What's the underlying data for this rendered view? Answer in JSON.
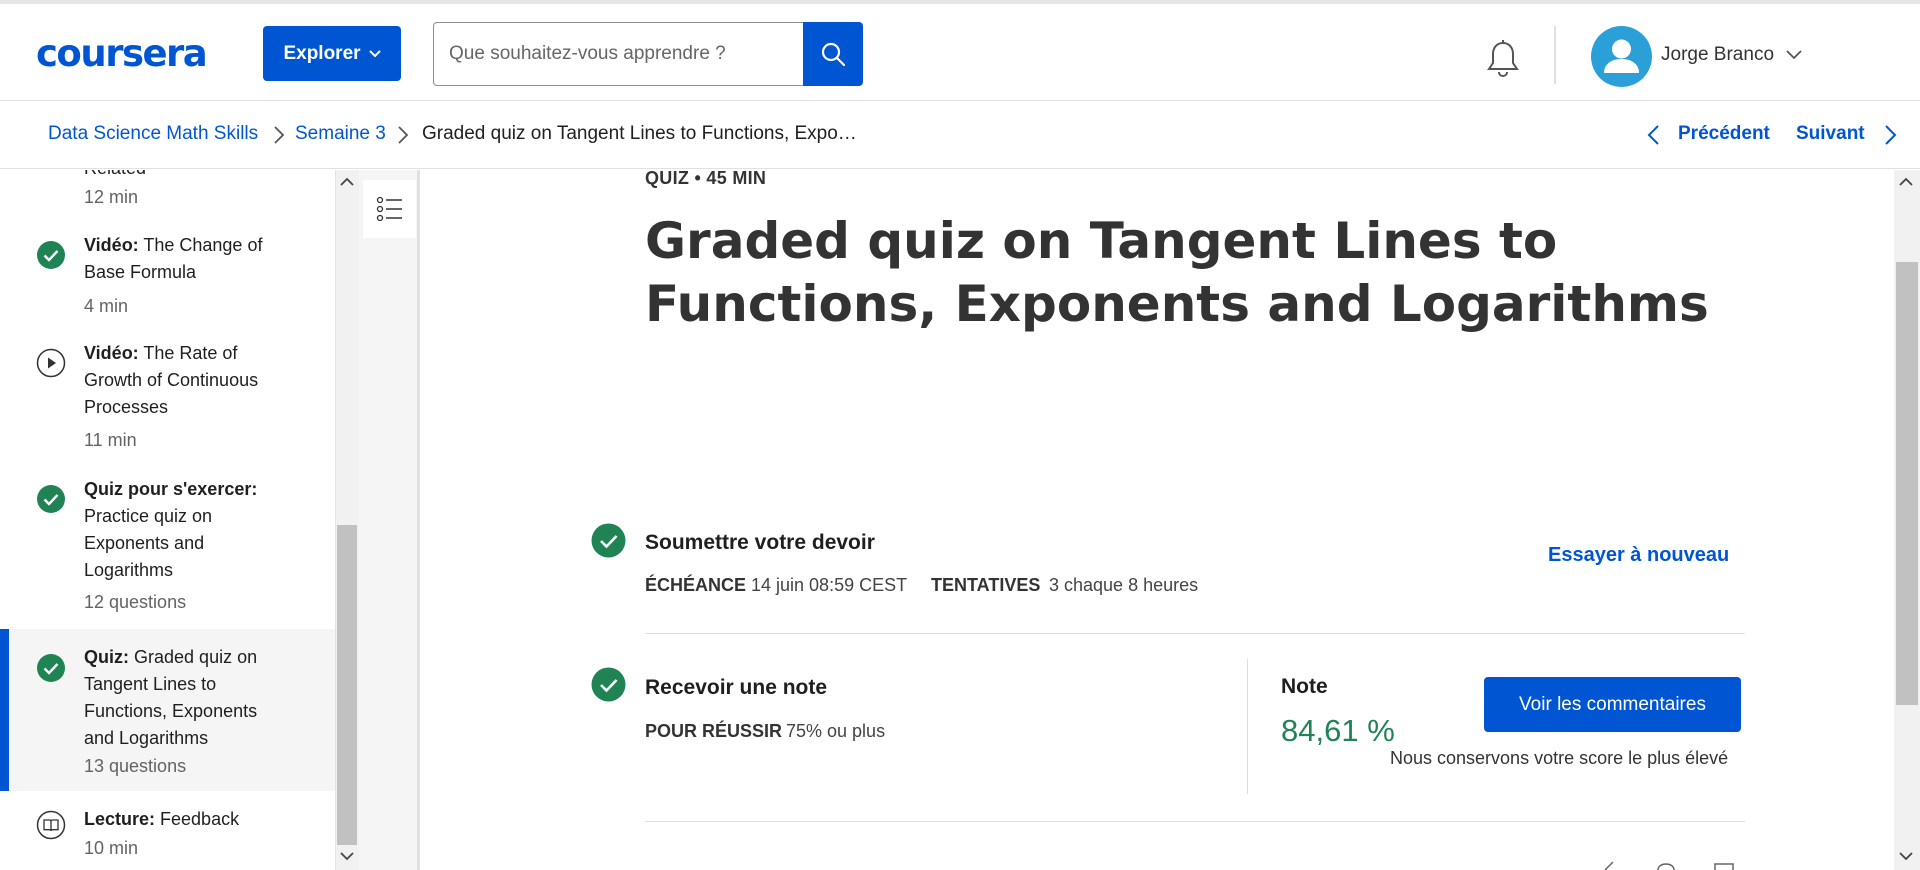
{
  "header": {
    "logo_text": "coursera",
    "explore_label": "Explorer",
    "search_placeholder": "Que souhaitez-vous apprendre ?",
    "user_name": "Jorge Branco",
    "brand_color": "#0056d2"
  },
  "breadcrumb": {
    "items": [
      "Data Science Math Skills",
      "Semaine 3",
      "Graded quiz on Tangent Lines to Functions, Expo…"
    ],
    "prev_label": "Précédent",
    "next_label": "Suivant"
  },
  "sidebar": {
    "items": [
      {
        "type_label": "",
        "title": "Related",
        "meta": "12 min",
        "icon": "check-circle-icon",
        "status": "completed"
      },
      {
        "type_label": "Vidéo:",
        "title": "The Change of Base Formula",
        "meta": "4 min",
        "icon": "check-circle-icon",
        "status": "completed"
      },
      {
        "type_label": "Vidéo:",
        "title": "The Rate of Growth of Continuous Processes",
        "meta": "11 min",
        "icon": "play-circle-icon",
        "status": "not-started"
      },
      {
        "type_label": "Quiz pour s'exercer:",
        "title": "Practice quiz on Exponents and Logarithms",
        "meta": "12 questions",
        "icon": "check-circle-icon",
        "status": "completed"
      },
      {
        "type_label": "Quiz:",
        "title": "Graded quiz on Tangent Lines to Functions, Exponents and Logarithms",
        "meta": "13 questions",
        "icon": "check-circle-icon",
        "status": "completed-active"
      },
      {
        "type_label": "Lecture:",
        "title": "Feedback",
        "meta": "10 min",
        "icon": "book-circle-icon",
        "status": "not-started"
      }
    ]
  },
  "quiz": {
    "meta": "QUIZ • 45 MIN",
    "title": "Graded quiz on Tangent Lines to Functions, Exponents and Logarithms",
    "submit": {
      "title": "Soumettre votre devoir",
      "due_label": "ÉCHÉANCE",
      "due_value": "14 juin 08:59 CEST",
      "attempts_label": "TENTATIVES",
      "attempts_value": "3 chaque 8 heures",
      "retry_label": "Essayer à nouveau"
    },
    "grade": {
      "title": "Recevoir une note",
      "pass_label": "POUR RÉUSSIR",
      "pass_value": "75% ou plus",
      "note_label": "Note",
      "note_value": "84,61 %",
      "feedback_button": "Voir les commentaires",
      "keep_note": "Nous conservons votre score le plus élevé",
      "grade_color": "#1f8354"
    }
  }
}
